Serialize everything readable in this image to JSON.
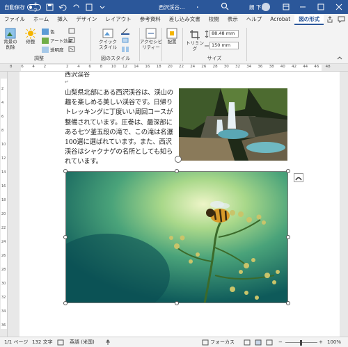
{
  "titlebar": {
    "autosave_label": "自動保存",
    "autosave_state": "オフ",
    "doc_title": "西沢渓谷…",
    "mode": "・",
    "user_name": "朗 下島"
  },
  "tabs": [
    "ファイル",
    "ホーム",
    "挿入",
    "デザイン",
    "レイアウト",
    "参考資料",
    "差し込み文書",
    "校閲",
    "表示",
    "ヘルプ",
    "Acrobat",
    "図の形式"
  ],
  "ribbon": {
    "adjust": {
      "bg_remove": "背景の\n削除",
      "correct": "修整",
      "color": "色",
      "art": "アート効果",
      "transparency": "透明度",
      "group_label": "調整"
    },
    "style": {
      "quick": "クイック\nスタイル",
      "group_label": "図のスタイル"
    },
    "access": {
      "alt_text": "アクセシビ\nリティー"
    },
    "arrange": {
      "position": "配置"
    },
    "size": {
      "crop": "トリミング",
      "height": "88.48 mm",
      "width": "150 mm",
      "group_label": "サイズ"
    }
  },
  "ruler": {
    "numbers": [
      "8",
      "6",
      "4",
      "2",
      "",
      "2",
      "4",
      "6",
      "8",
      "10",
      "12",
      "14",
      "16",
      "18",
      "20",
      "22",
      "24",
      "26",
      "28",
      "30",
      "32",
      "34",
      "36",
      "38",
      "40",
      "42",
      "44",
      "46",
      "48"
    ]
  },
  "vruler": {
    "numbers": [
      "2",
      "4",
      "6",
      "8",
      "10",
      "12",
      "14",
      "16",
      "18",
      "20",
      "22",
      "24",
      "26",
      "28",
      "30",
      "32",
      "34",
      "36"
    ]
  },
  "document": {
    "heading_fragment": "西沢渓谷",
    "body": "山梨県北部にある西沢渓谷は、渓山の趣を楽しめる美しい渓谷です。日帰りトレッキングに丁度いい周回コースが整備されています。圧巻は、最深部にある七ツ釜五段の滝で、この滝は名瀑100選に選ばれています。また、西沢渓谷はシャクナゲの名所としても知られています。",
    "para_mark": "↵"
  },
  "status": {
    "page": "1/1 ページ",
    "words": "132 文字",
    "lang": "英語 (米国)",
    "focus": "フォーカス",
    "zoom": "100%"
  },
  "colors": {
    "accent": "#2b579a",
    "ribbon_bg": "#f3f3f3"
  }
}
